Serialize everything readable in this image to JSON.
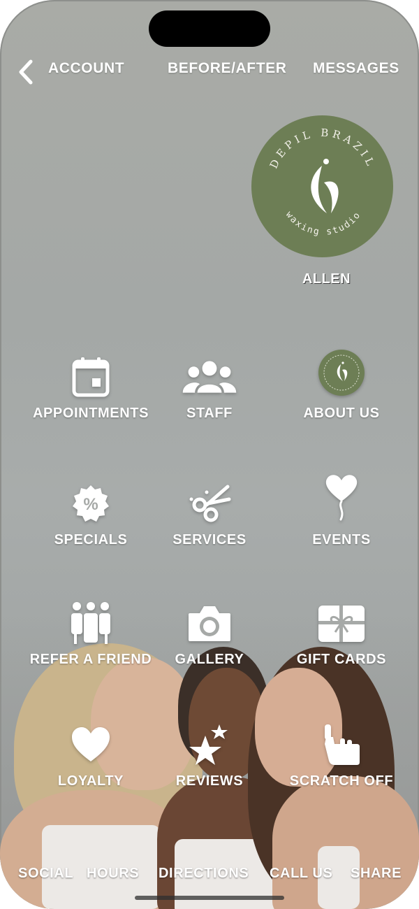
{
  "nav": {
    "account": "ACCOUNT",
    "before_after": "BEFORE/AFTER",
    "messages": "MESSAGES"
  },
  "brand": {
    "name": "DEPIL BRAZIL",
    "tagline": "waxing studio",
    "color": "#6d7e55"
  },
  "location": "ALLEN",
  "grid": [
    {
      "label": "APPOINTMENTS",
      "icon": "calendar-icon"
    },
    {
      "label": "STAFF",
      "icon": "people-group-icon"
    },
    {
      "label": "ABOUT US",
      "icon": "brand-logo-icon"
    },
    {
      "label": "SPECIALS",
      "icon": "percent-badge-icon"
    },
    {
      "label": "SERVICES",
      "icon": "scissors-icon"
    },
    {
      "label": "EVENTS",
      "icon": "heart-balloon-icon"
    },
    {
      "label": "REFER A FRIEND",
      "icon": "friends-icon"
    },
    {
      "label": "GALLERY",
      "icon": "camera-icon"
    },
    {
      "label": "GIFT CARDS",
      "icon": "gift-card-icon"
    },
    {
      "label": "LOYALTY",
      "icon": "heart-icon"
    },
    {
      "label": "REVIEWS",
      "icon": "stars-icon"
    },
    {
      "label": "SCRATCH OFF",
      "icon": "pointer-hand-icon"
    }
  ],
  "bottom_bar": [
    "SOCIAL",
    "HOURS",
    "DIRECTIONS",
    "CALL US",
    "SHARE"
  ]
}
